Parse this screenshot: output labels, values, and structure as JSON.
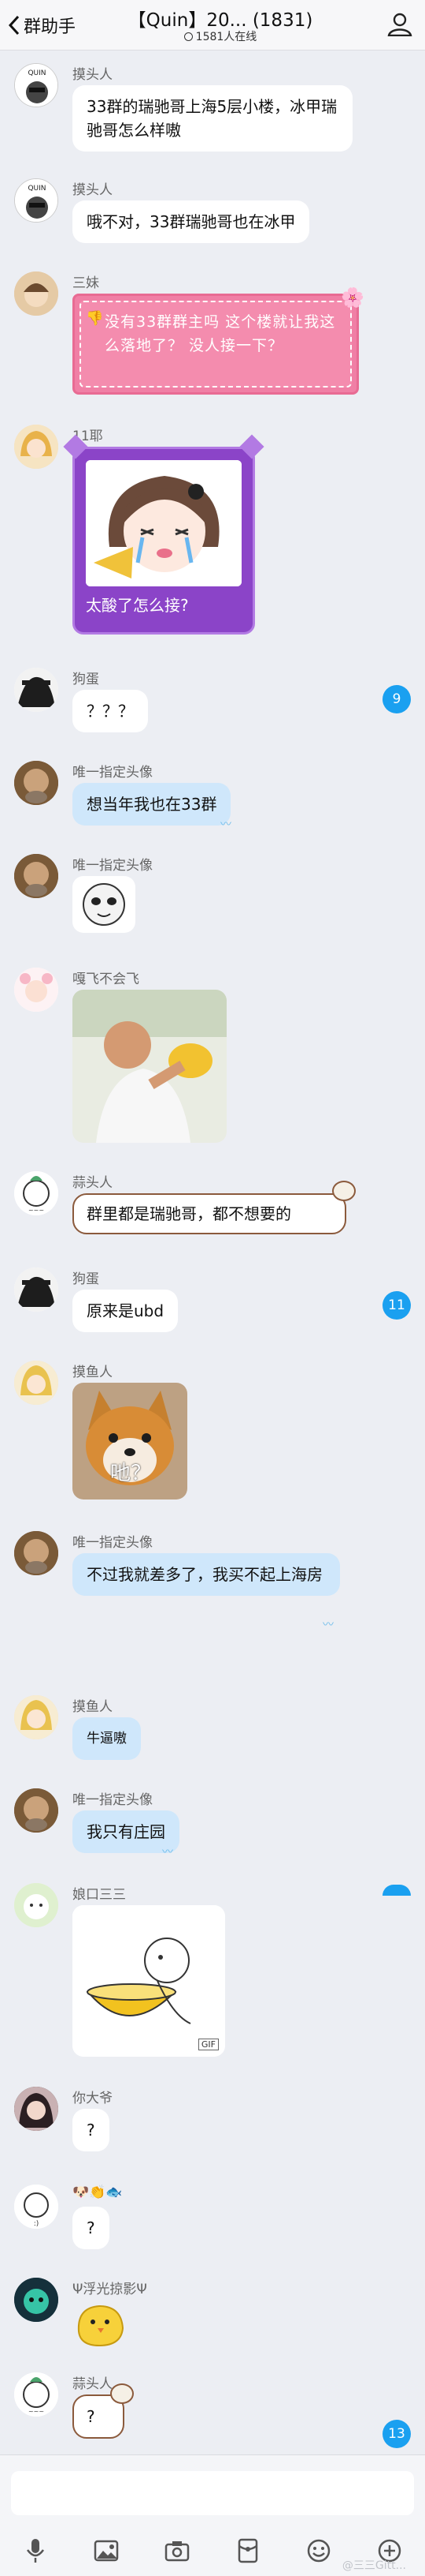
{
  "header": {
    "back_label": "群助手",
    "title": "【Quin】20... (1831)",
    "online": "1581人在线"
  },
  "messages": [
    {
      "nick": "摸头人",
      "text": "33群的瑞驰哥上海5层小楼，冰甲瑞驰哥怎么样嗷"
    },
    {
      "nick": "摸头人",
      "text": "哦不对，33群瑞驰哥也在冰甲"
    },
    {
      "nick": "三妹",
      "text": "没有33群群主吗 这个楼就让我这么落地了？ 没人接一下？"
    },
    {
      "nick": "11耶",
      "sticker_text": "太酸了怎么接?"
    },
    {
      "nick": "狗蛋",
      "text": "？？？",
      "badge": "9"
    },
    {
      "nick": "唯一指定头像",
      "text": "想当年我也在33群"
    },
    {
      "nick": "唯一指定头像"
    },
    {
      "nick": "嘎飞不会飞"
    },
    {
      "nick": "蒜头人",
      "text": "群里都是瑞驰哥，都不想要的"
    },
    {
      "nick": "狗蛋",
      "text": "原来是ubd",
      "badge": "11"
    },
    {
      "nick": "摸鱼人",
      "sticker_text": "吔？"
    },
    {
      "nick": "唯一指定头像",
      "text": "不过我就差多了，我买不起上海房"
    },
    {
      "nick": "摸鱼人",
      "text": "牛逼嗷"
    },
    {
      "nick": "唯一指定头像",
      "text": "我只有庄园"
    },
    {
      "nick": "娘口三三",
      "gif_label": "GIF"
    },
    {
      "nick": "你大爷",
      "text": "?"
    },
    {
      "nick": "🐶👏🐟",
      "text": "?"
    },
    {
      "nick": "Ψ浮光掠影Ψ"
    },
    {
      "nick": "蒜头人",
      "text": "?",
      "badge": "13"
    }
  ],
  "watermark": "@三三Gitt..."
}
